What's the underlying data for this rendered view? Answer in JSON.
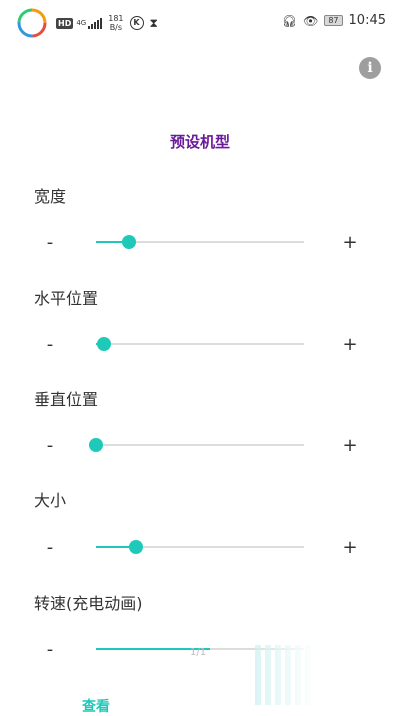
{
  "status_bar": {
    "hd": "HD",
    "network": "4G",
    "speed_value": "181",
    "speed_unit": "B/s",
    "k_icon": "K",
    "battery": "87",
    "time": "10:45"
  },
  "page": {
    "title": "预设机型"
  },
  "sliders": [
    {
      "label": "宽度",
      "minus": "-",
      "plus": "+",
      "value": 0.16
    },
    {
      "label": "水平位置",
      "minus": "-",
      "plus": "+",
      "value": 0.04
    },
    {
      "label": "垂直位置",
      "minus": "-",
      "plus": "+",
      "value": 0.0
    },
    {
      "label": "大小",
      "minus": "-",
      "plus": "+",
      "value": 0.19
    },
    {
      "label": "转速(充电动画)",
      "minus": "-",
      "plus": "+",
      "value": 0.55
    }
  ],
  "footer": {
    "view_button": "查看",
    "toast_text": "1/1"
  },
  "colors": {
    "accent": "#1ec9b9",
    "title": "#6a1b9a"
  }
}
